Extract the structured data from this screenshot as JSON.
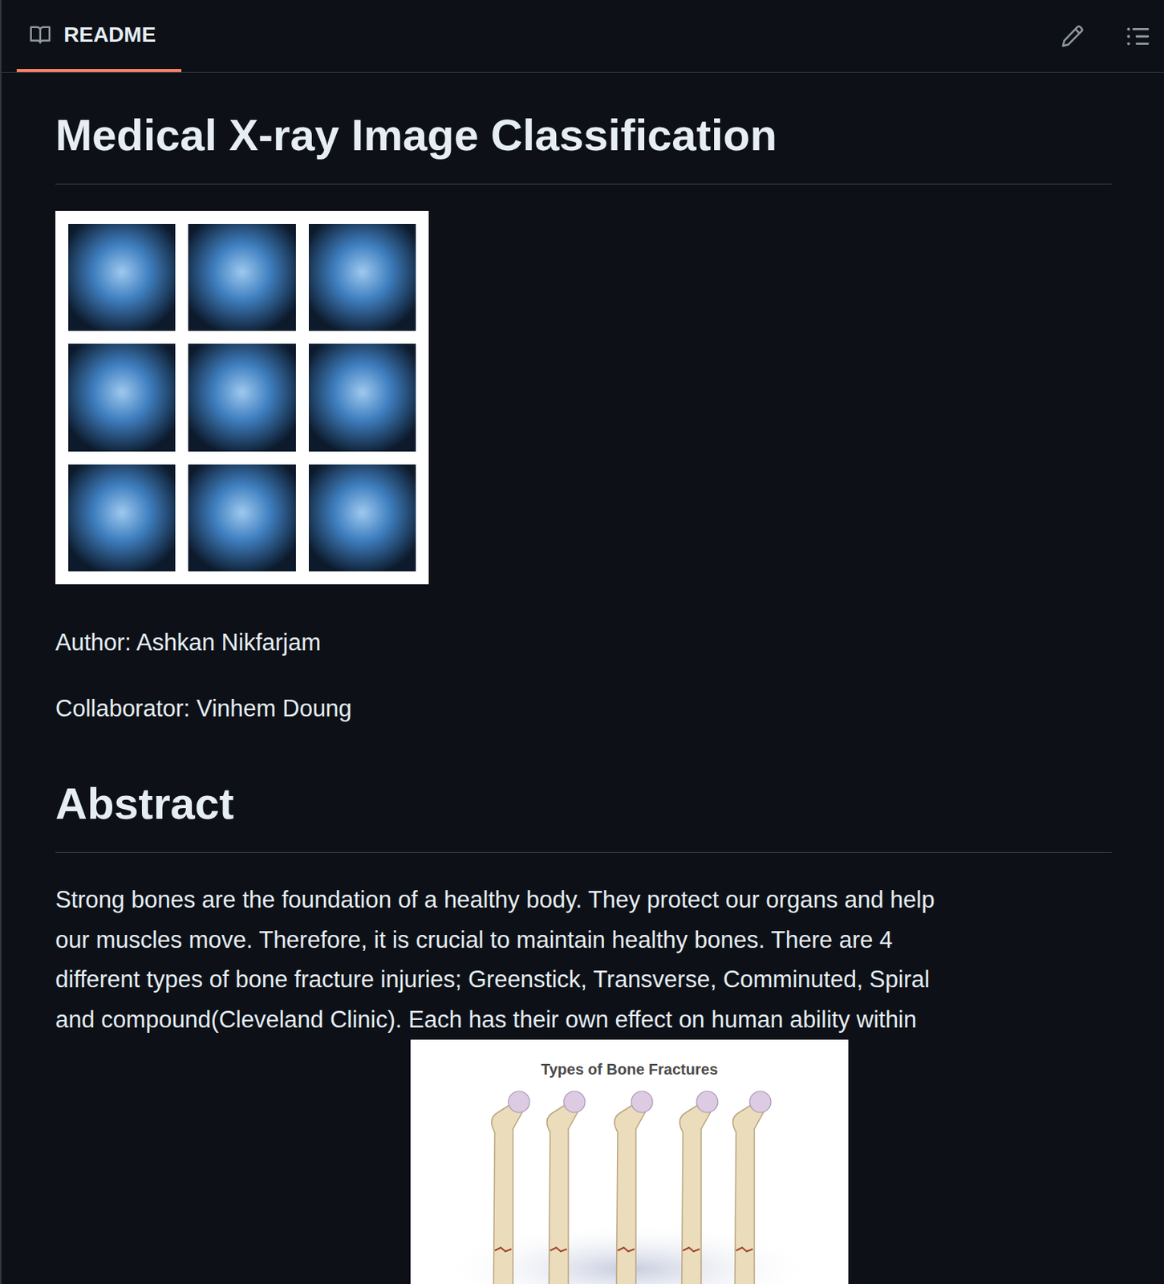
{
  "header": {
    "tab": {
      "label": "README",
      "selected": true
    }
  },
  "title": "Medical X-ray Image Classification",
  "credits": [
    "Author: Ashkan Nikfarjam",
    "Collaborator: Vinhem Doung"
  ],
  "sections": [
    {
      "heading": "Abstract",
      "lines": [
        "Strong bones are the foundation of a healthy body. They protect our organs and help",
        "our muscles move. Therefore, it is crucial to maintain healthy bones. There are 4",
        "different types of bone fracture injuries; Greenstick, Transverse, Comminuted, Spiral",
        "and compound(Cleveland Clinic). Each has their own effect on human ability within"
      ]
    }
  ],
  "figure": {
    "title": "Types of Bone Fractures"
  }
}
